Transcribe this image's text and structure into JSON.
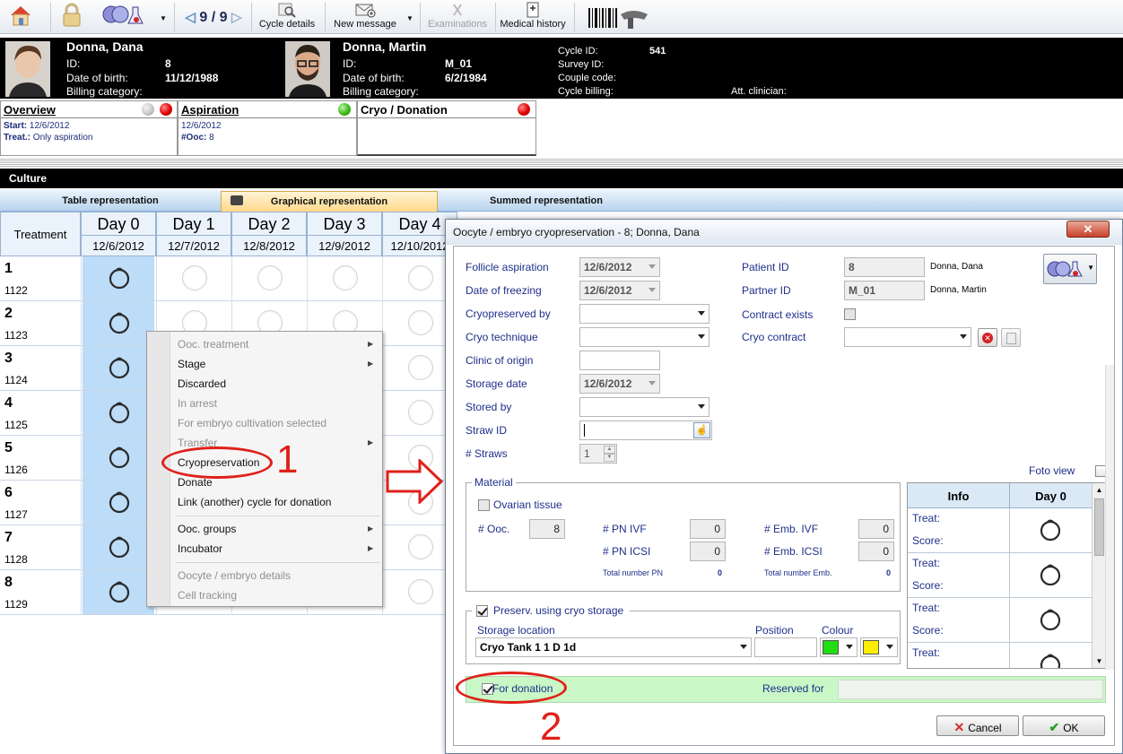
{
  "toolbar": {
    "pager": "9 / 9",
    "cycle_details": "Cycle details",
    "new_message": "New message",
    "examinations": "Examinations",
    "medical_history": "Medical history"
  },
  "patient": {
    "name": "Donna, Dana",
    "id_label": "ID:",
    "id": "8",
    "dob_label": "Date of birth:",
    "dob": "11/12/1988",
    "billing_label": "Billing category:"
  },
  "partner": {
    "name": "Donna, Martin",
    "id_label": "ID:",
    "id": "M_01",
    "dob_label": "Date of birth:",
    "dob": "6/2/1984",
    "billing_label": "Billing category:"
  },
  "cycle": {
    "cycle_id_label": "Cycle ID:",
    "cycle_id": "541",
    "survey_id_label": "Survey ID:",
    "couple_code_label": "Couple code:",
    "cycle_billing_label": "Cycle billing:",
    "att_clinician_label": "Att. clinician:"
  },
  "panels": {
    "overview": {
      "title": "Overview",
      "start_label": "Start:",
      "start": "12/6/2012",
      "treat_label": "Treat.:",
      "treat": "Only aspiration"
    },
    "aspiration": {
      "title": "Aspiration",
      "date": "12/6/2012",
      "ooc_label": "#Ooc:",
      "ooc": "8"
    },
    "cryo": {
      "title": "Cryo / Donation"
    }
  },
  "culture": {
    "title": "Culture"
  },
  "tabs": [
    "Table representation",
    "Graphical representation",
    "Summed representation"
  ],
  "grid": {
    "treatment_header": "Treatment",
    "days": [
      {
        "name": "Day 0",
        "date": "12/6/2012"
      },
      {
        "name": "Day 1",
        "date": "12/7/2012"
      },
      {
        "name": "Day 2",
        "date": "12/8/2012"
      },
      {
        "name": "Day 3",
        "date": "12/9/2012"
      },
      {
        "name": "Day 4",
        "date": "12/10/2012"
      }
    ],
    "rows": [
      {
        "num": "1",
        "id": "1122"
      },
      {
        "num": "2",
        "id": "1123"
      },
      {
        "num": "3",
        "id": "1124"
      },
      {
        "num": "4",
        "id": "1125"
      },
      {
        "num": "5",
        "id": "1126"
      },
      {
        "num": "6",
        "id": "1127"
      },
      {
        "num": "7",
        "id": "1128"
      },
      {
        "num": "8",
        "id": "1129"
      }
    ]
  },
  "context_menu": {
    "items": [
      "Ooc. treatment",
      "Stage",
      "Discarded",
      "In arrest",
      "For embryo cultivation selected",
      "Transfer",
      "Cryopreservation",
      "Donate",
      "Link (another) cycle for donation",
      "Ooc. groups",
      "Incubator",
      "Oocyte / embryo details",
      "Cell tracking"
    ]
  },
  "annotations": {
    "one": "1",
    "two": "2"
  },
  "dialog": {
    "title": "Oocyte / embryo cryopreservation - 8; Donna, Dana",
    "close": "✕",
    "follicle_aspiration_label": "Follicle aspiration",
    "follicle_aspiration": "12/6/2012",
    "date_of_freezing_label": "Date of freezing",
    "date_of_freezing": "12/6/2012",
    "cryopreserved_by_label": "Cryopreserved by",
    "cryo_technique_label": "Cryo technique",
    "clinic_of_origin_label": "Clinic of origin",
    "storage_date_label": "Storage date",
    "storage_date": "12/6/2012",
    "stored_by_label": "Stored by",
    "straw_id_label": "Straw ID",
    "straws_label": "# Straws",
    "straws": "1",
    "patient_id_label": "Patient ID",
    "patient_id": "8",
    "patient_name": "Donna, Dana",
    "partner_id_label": "Partner ID",
    "partner_id": "M_01",
    "partner_name": "Donna, Martin",
    "contract_exists_label": "Contract exists",
    "cryo_contract_label": "Cryo contract",
    "foto_view_label": "Foto view",
    "material": {
      "title": "Material",
      "ovarian_tissue": "Ovarian tissue",
      "ooc_label": "# Ooc.",
      "ooc": "8",
      "pn_ivf_label": "# PN IVF",
      "pn_ivf": "0",
      "pn_icsi_label": "# PN ICSI",
      "pn_icsi": "0",
      "total_pn_label": "Total number PN",
      "total_pn": "0",
      "emb_ivf_label": "# Emb. IVF",
      "emb_ivf": "0",
      "emb_icsi_label": "# Emb. ICSI",
      "emb_icsi": "0",
      "total_emb_label": "Total number Emb.",
      "total_emb": "0"
    },
    "info_table": {
      "info_header": "Info",
      "day_header": "Day 0",
      "treat_label": "Treat:",
      "score_label": "Score:"
    },
    "preserv": {
      "label": "Preserv. using cryo storage",
      "storage_location_label": "Storage location",
      "storage_location": "Cryo Tank 1 1 D 1d",
      "position_label": "Position",
      "colour_label": "Colour",
      "colour1": "#22dd11",
      "colour2": "#ffee00"
    },
    "for_donation_label": "For donation",
    "reserved_for_label": "Reserved for",
    "cancel": "Cancel",
    "ok": "OK"
  }
}
